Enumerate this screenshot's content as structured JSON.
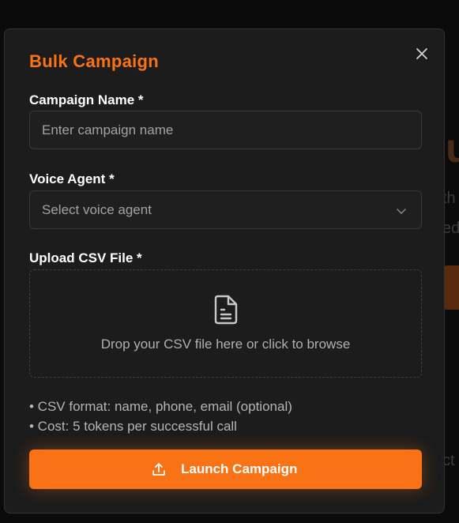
{
  "background": {
    "fragment_big": "u",
    "fragment_line1": "th",
    "fragment_line2": "ed",
    "fragment_line3": "ct"
  },
  "modal": {
    "title": "Bulk Campaign",
    "close_icon": "close-icon",
    "campaign_name": {
      "label": "Campaign Name *",
      "placeholder": "Enter campaign name",
      "value": ""
    },
    "voice_agent": {
      "label": "Voice Agent *",
      "placeholder": "Select voice agent",
      "chevron_icon": "chevron-down-icon"
    },
    "csv_upload": {
      "label": "Upload CSV File *",
      "icon": "file-text-icon",
      "drop_text": "Drop your CSV file here or click to browse"
    },
    "notes": [
      "• CSV format: name, phone, email (optional)",
      "• Cost: 5 tokens per successful call"
    ],
    "launch_button": {
      "label": "Launch Campaign",
      "icon": "upload-icon"
    }
  },
  "colors": {
    "accent": "#f97316",
    "modal_bg": "#1c1c1c",
    "text_primary": "#ffffff",
    "text_muted": "#a3a3a3"
  }
}
